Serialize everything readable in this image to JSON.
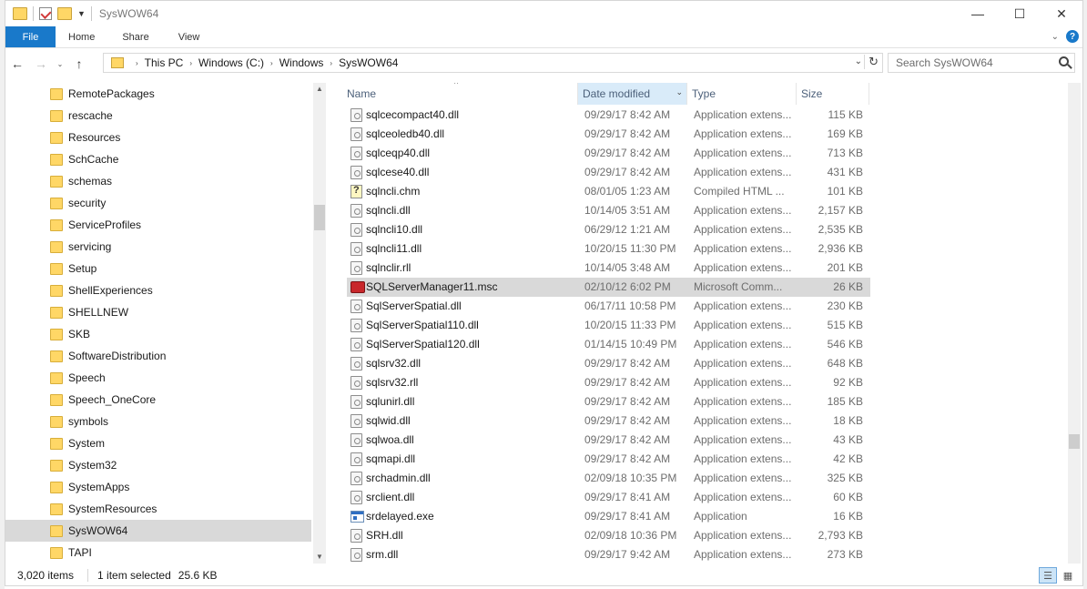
{
  "window": {
    "title": "SysWOW64",
    "controls": {
      "minimize": "—",
      "maximize": "☐",
      "close": "✕"
    }
  },
  "ribbon": {
    "tabs": [
      {
        "label": "File"
      },
      {
        "label": "Home"
      },
      {
        "label": "Share"
      },
      {
        "label": "View"
      }
    ]
  },
  "address": {
    "crumbs": [
      "This PC",
      "Windows (C:)",
      "Windows",
      "SysWOW64"
    ]
  },
  "search": {
    "placeholder": "Search SysWOW64"
  },
  "nav": {
    "items": [
      "RemotePackages",
      "rescache",
      "Resources",
      "SchCache",
      "schemas",
      "security",
      "ServiceProfiles",
      "servicing",
      "Setup",
      "ShellExperiences",
      "SHELLNEW",
      "SKB",
      "SoftwareDistribution",
      "Speech",
      "Speech_OneCore",
      "symbols",
      "System",
      "System32",
      "SystemApps",
      "SystemResources",
      "SysWOW64",
      "TAPI"
    ],
    "selected": "SysWOW64"
  },
  "columns": {
    "name": "Name",
    "date": "Date modified",
    "type": "Type",
    "size": "Size"
  },
  "files": [
    {
      "name": "sqlcecompact40.dll",
      "date": "09/29/17 8:42 AM",
      "type": "Application extens...",
      "size": "115 KB",
      "icon": "dll-icon"
    },
    {
      "name": "sqlceoledb40.dll",
      "date": "09/29/17 8:42 AM",
      "type": "Application extens...",
      "size": "169 KB",
      "icon": "dll-icon"
    },
    {
      "name": "sqlceqp40.dll",
      "date": "09/29/17 8:42 AM",
      "type": "Application extens...",
      "size": "713 KB",
      "icon": "dll-icon"
    },
    {
      "name": "sqlcese40.dll",
      "date": "09/29/17 8:42 AM",
      "type": "Application extens...",
      "size": "431 KB",
      "icon": "dll-icon"
    },
    {
      "name": "sqlncli.chm",
      "date": "08/01/05 1:23 AM",
      "type": "Compiled HTML ...",
      "size": "101 KB",
      "icon": "chm-icon"
    },
    {
      "name": "sqlncli.dll",
      "date": "10/14/05 3:51 AM",
      "type": "Application extens...",
      "size": "2,157 KB",
      "icon": "dll-icon"
    },
    {
      "name": "sqlncli10.dll",
      "date": "06/29/12 1:21 AM",
      "type": "Application extens...",
      "size": "2,535 KB",
      "icon": "dll-icon"
    },
    {
      "name": "sqlncli11.dll",
      "date": "10/20/15 11:30 PM",
      "type": "Application extens...",
      "size": "2,936 KB",
      "icon": "dll-icon"
    },
    {
      "name": "sqlnclir.rll",
      "date": "10/14/05 3:48 AM",
      "type": "Application extens...",
      "size": "201 KB",
      "icon": "dll-icon"
    },
    {
      "name": "SQLServerManager11.msc",
      "date": "02/10/12 6:02 PM",
      "type": "Microsoft Comm...",
      "size": "26 KB",
      "icon": "msc-icon",
      "selected": true
    },
    {
      "name": "SqlServerSpatial.dll",
      "date": "06/17/11 10:58 PM",
      "type": "Application extens...",
      "size": "230 KB",
      "icon": "dll-icon"
    },
    {
      "name": "SqlServerSpatial110.dll",
      "date": "10/20/15 11:33 PM",
      "type": "Application extens...",
      "size": "515 KB",
      "icon": "dll-icon"
    },
    {
      "name": "SqlServerSpatial120.dll",
      "date": "01/14/15 10:49 PM",
      "type": "Application extens...",
      "size": "546 KB",
      "icon": "dll-icon"
    },
    {
      "name": "sqlsrv32.dll",
      "date": "09/29/17 8:42 AM",
      "type": "Application extens...",
      "size": "648 KB",
      "icon": "dll-icon"
    },
    {
      "name": "sqlsrv32.rll",
      "date": "09/29/17 8:42 AM",
      "type": "Application extens...",
      "size": "92 KB",
      "icon": "dll-icon"
    },
    {
      "name": "sqlunirl.dll",
      "date": "09/29/17 8:42 AM",
      "type": "Application extens...",
      "size": "185 KB",
      "icon": "dll-icon"
    },
    {
      "name": "sqlwid.dll",
      "date": "09/29/17 8:42 AM",
      "type": "Application extens...",
      "size": "18 KB",
      "icon": "dll-icon"
    },
    {
      "name": "sqlwoa.dll",
      "date": "09/29/17 8:42 AM",
      "type": "Application extens...",
      "size": "43 KB",
      "icon": "dll-icon"
    },
    {
      "name": "sqmapi.dll",
      "date": "09/29/17 8:42 AM",
      "type": "Application extens...",
      "size": "42 KB",
      "icon": "dll-icon"
    },
    {
      "name": "srchadmin.dll",
      "date": "02/09/18 10:35 PM",
      "type": "Application extens...",
      "size": "325 KB",
      "icon": "dll-icon"
    },
    {
      "name": "srclient.dll",
      "date": "09/29/17 8:41 AM",
      "type": "Application extens...",
      "size": "60 KB",
      "icon": "dll-icon"
    },
    {
      "name": "srdelayed.exe",
      "date": "09/29/17 8:41 AM",
      "type": "Application",
      "size": "16 KB",
      "icon": "exe-icon"
    },
    {
      "name": "SRH.dll",
      "date": "02/09/18 10:36 PM",
      "type": "Application extens...",
      "size": "2,793 KB",
      "icon": "dll-icon"
    },
    {
      "name": "srm.dll",
      "date": "09/29/17 9:42 AM",
      "type": "Application extens...",
      "size": "273 KB",
      "icon": "dll-icon"
    }
  ],
  "status": {
    "count": "3,020 items",
    "selection": "1 item selected",
    "size": "25.6 KB"
  }
}
